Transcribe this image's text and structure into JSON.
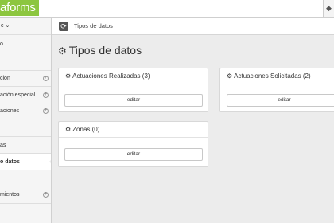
{
  "header": {
    "logo": "aforms",
    "right_icon": "◆"
  },
  "breadcrumb": {
    "icon": "refresh-icon",
    "text": "Tipos de datos"
  },
  "sidebar": {
    "user": "c ⌄",
    "items": [
      {
        "label": "o"
      },
      {
        "label": ""
      },
      {
        "label": "ción"
      },
      {
        "label": "ación especial"
      },
      {
        "label": "aciones"
      },
      {
        "label": ""
      },
      {
        "label": "as"
      },
      {
        "label": "o datos"
      },
      {
        "label": ""
      },
      {
        "label": "mientos"
      }
    ]
  },
  "page": {
    "title": "Tipos de datos"
  },
  "cards": [
    {
      "title": "Actuaciones Realizadas (3)",
      "button": "editar"
    },
    {
      "title": "Actuaciones Solicitadas (2)",
      "button": "editar"
    },
    {
      "title": "Zonas (0)",
      "button": "editar"
    }
  ]
}
